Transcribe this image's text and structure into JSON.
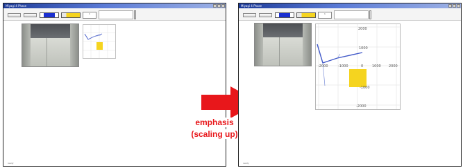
{
  "left_window": {
    "title": "Miyagi 4 Phase",
    "buttons": [
      "",
      ""
    ],
    "field": "1",
    "status_lines": [
      "",
      ""
    ],
    "footer": "ready",
    "map": {
      "tick_labels": []
    }
  },
  "right_window": {
    "title": "Miyagi 4 Phase",
    "buttons": [
      "",
      ""
    ],
    "field": "1",
    "status_lines": [
      "",
      ""
    ],
    "footer": "ready",
    "map": {
      "x_tick_labels": [
        "-2000",
        "-1000",
        "0",
        "1000",
        "2000"
      ],
      "y_tick_labels": [
        "2000",
        "1000",
        "-1000",
        "-2000"
      ]
    }
  },
  "annotation": {
    "line1": "emphasis",
    "line2": "(scaling up)"
  },
  "colors": {
    "arrow": "#e8171b",
    "target_box": "#f5d41f",
    "trajectory": "#4058c8",
    "titlebar": "#1c3a98"
  }
}
